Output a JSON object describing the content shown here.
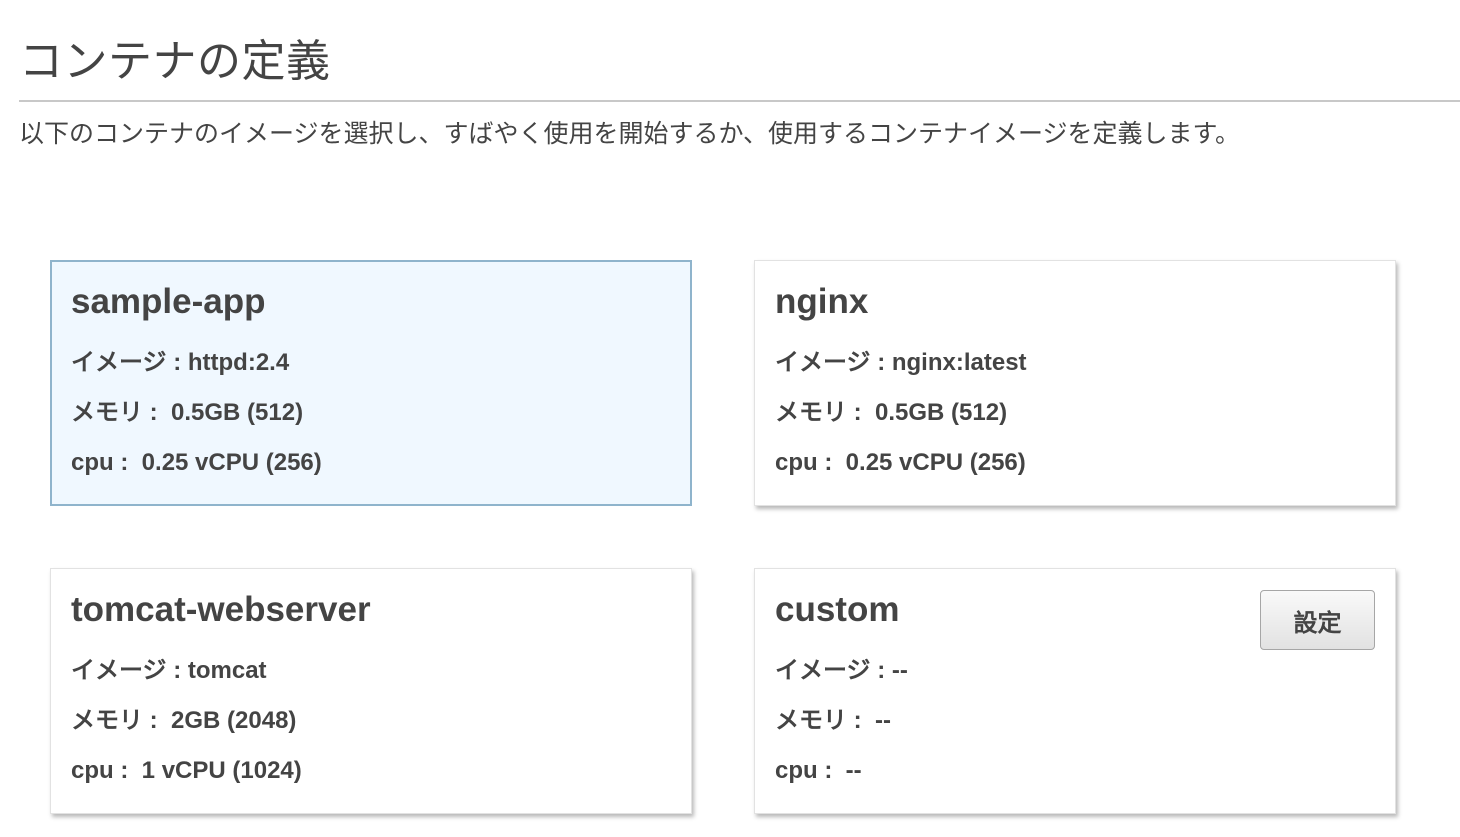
{
  "header": {
    "title": "コンテナの定義",
    "description": "以下のコンテナのイメージを選択し、すばやく使用を開始するか、使用するコンテナイメージを定義します。"
  },
  "field_labels": {
    "image": "イメージ :",
    "memory": "メモリ :",
    "cpu": "cpu :"
  },
  "cards": [
    {
      "name": "sample-app",
      "image": "httpd:2.4",
      "memory": "0.5GB (512)",
      "cpu": "0.25 vCPU (256)",
      "selected": true
    },
    {
      "name": "nginx",
      "image": "nginx:latest",
      "memory": "0.5GB (512)",
      "cpu": "0.25 vCPU (256)",
      "selected": false
    },
    {
      "name": "tomcat-webserver",
      "image": "tomcat",
      "memory": "2GB (2048)",
      "cpu": "1 vCPU (1024)",
      "selected": false
    },
    {
      "name": "custom",
      "image": "--",
      "memory": "--",
      "cpu": "--",
      "selected": false,
      "button_label": "設定"
    }
  ],
  "colors": {
    "selected_background": "#f0f8ff",
    "selected_border": "#8fb4cc",
    "text": "#444444"
  }
}
